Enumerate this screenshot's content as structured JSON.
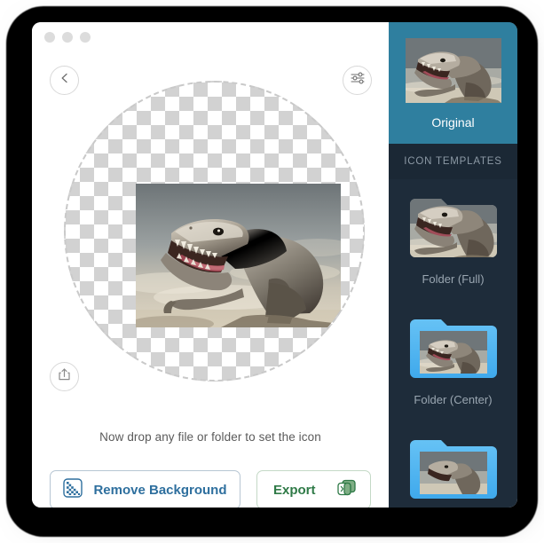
{
  "window": {
    "traffic_lights": [
      "close",
      "minimize",
      "zoom"
    ]
  },
  "toolbar": {
    "back_icon": "chevron-left-icon",
    "prefs_icon": "sliders-icon",
    "share_icon": "share-upload-icon"
  },
  "main": {
    "drop_hint": "Now drop any file or folder to set the icon",
    "artwork_alt": "t-rex-dinosaur-roaring",
    "canvas_background": "transparency-checkerboard",
    "buttons": {
      "remove_background": {
        "label": "Remove Background",
        "icon": "transparency-grid-icon",
        "color": "#2e6f9e",
        "border": "#b7c6d3"
      },
      "export": {
        "label": "Export",
        "icon": "export-windows-icon",
        "color": "#2f7a47",
        "border": "#c4d9c6"
      }
    }
  },
  "sidebar": {
    "background": "#1e2c3a",
    "selected_color": "#2f7f9f",
    "section_header": "ICON TEMPLATES",
    "items": [
      {
        "label": "Original",
        "selected": true,
        "style": "plain"
      },
      {
        "label": "Folder (Full)",
        "selected": false,
        "style": "folder-full"
      },
      {
        "label": "Folder (Center)",
        "selected": false,
        "style": "folder-center"
      },
      {
        "label": "",
        "selected": false,
        "style": "folder-center"
      }
    ]
  }
}
